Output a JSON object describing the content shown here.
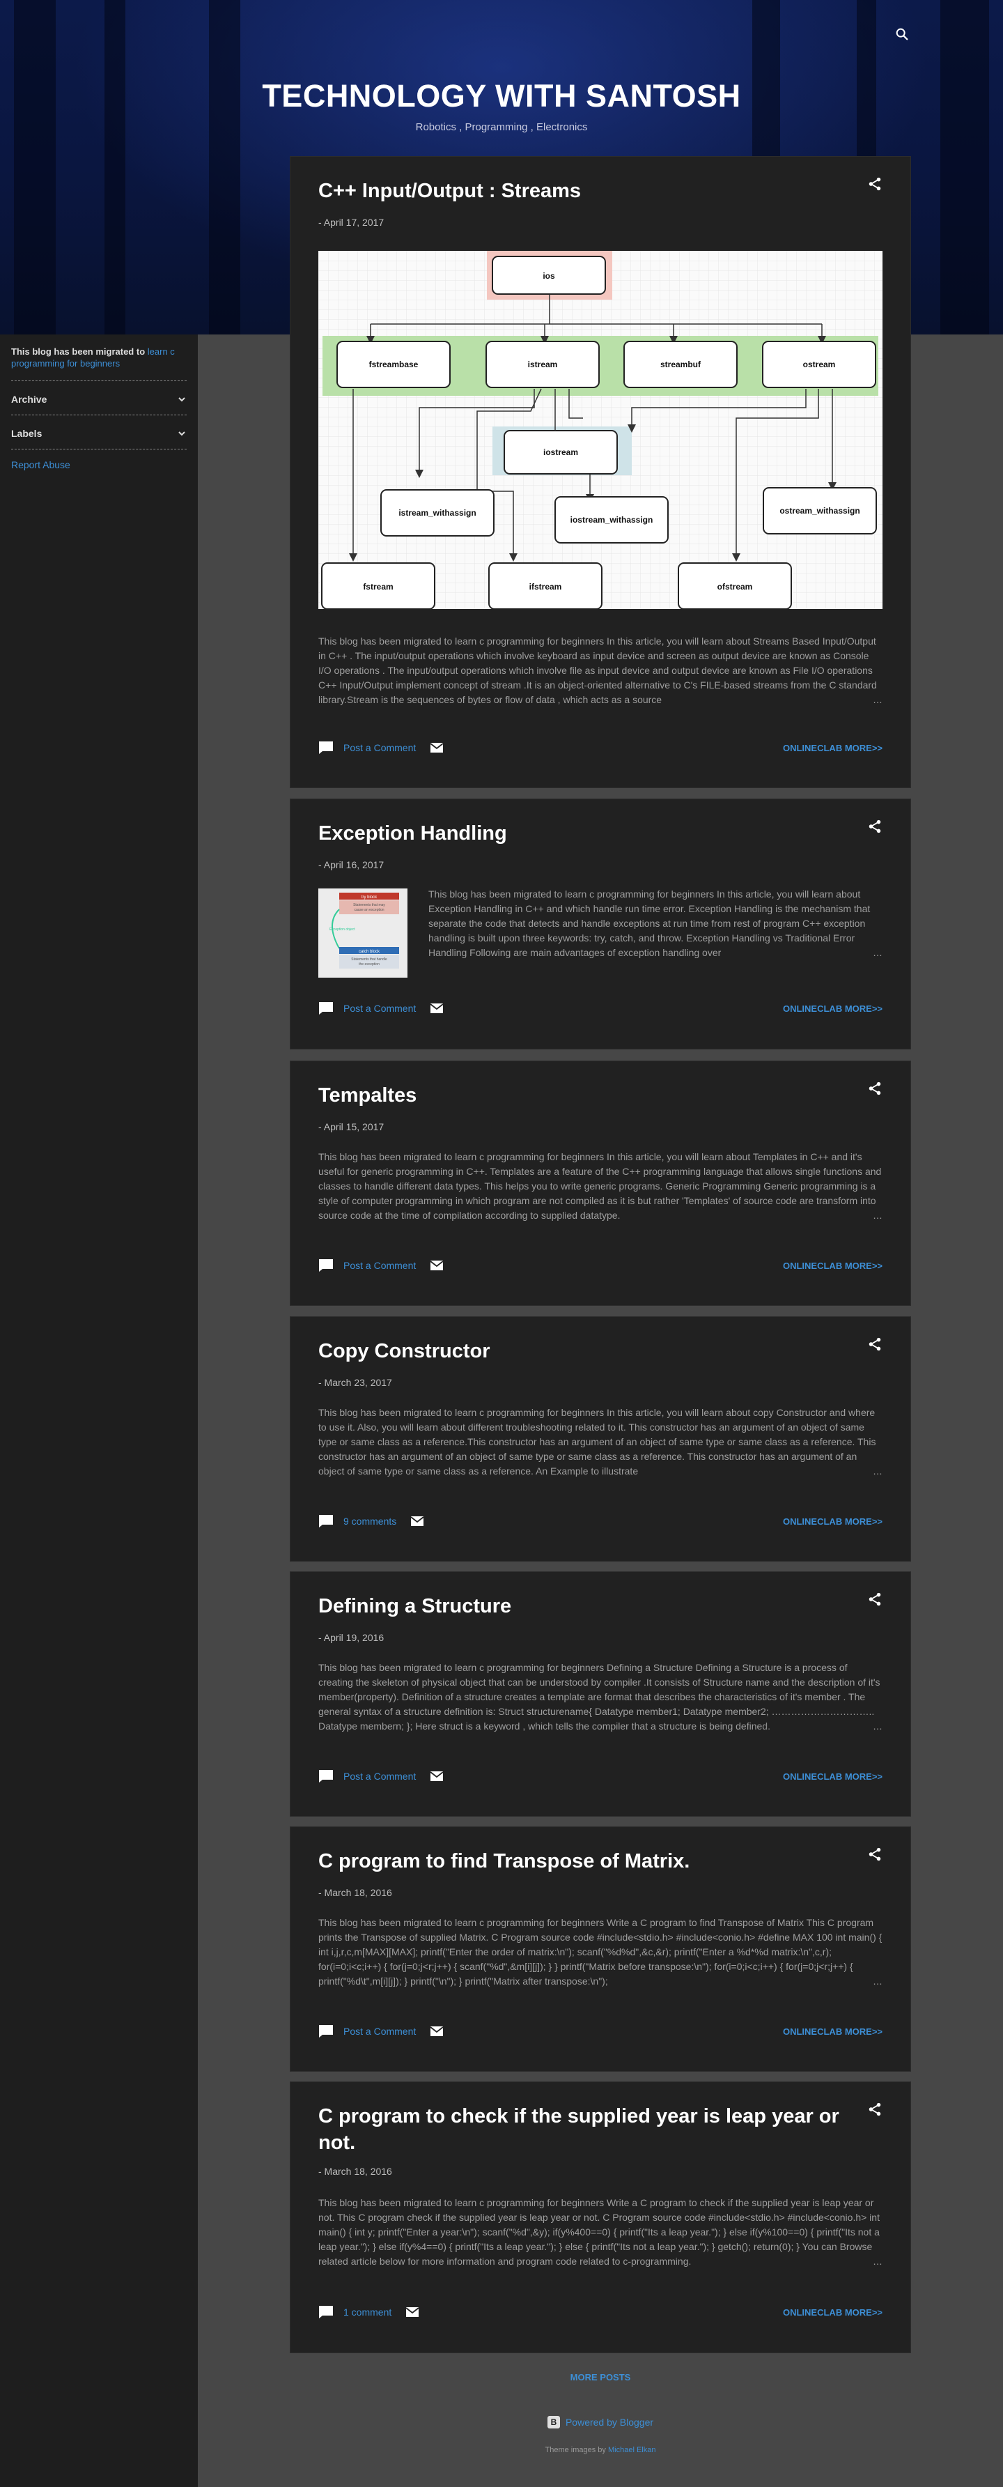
{
  "header": {
    "title": "TECHNOLOGY WITH SANTOSH",
    "subtitle": "Robotics , Programming , Electronics"
  },
  "sidebar": {
    "note_bold": "This blog has been migrated to",
    "note_link": "learn c programming for beginners",
    "archive": "Archive",
    "labels": "Labels",
    "report": "Report Abuse"
  },
  "diagram": {
    "nodes": [
      "ios",
      "fstreambase",
      "istream",
      "streambuf",
      "ostream",
      "iostream",
      "istream_withassign",
      "iostream_withassign",
      "ostream_withassign",
      "fstream",
      "ifstream",
      "ofstream"
    ]
  },
  "thumb2": {
    "lines": [
      "try block",
      "Statements that may",
      "cause an exception",
      "Exception object",
      "catch block",
      "Statements that handle",
      "the exception"
    ]
  },
  "posts": [
    {
      "title": "C++ Input/Output : Streams",
      "date": "- April 17, 2017",
      "snippet": "This blog has been migrated to learn c programming for beginners In this article, you will learn about Streams Based Input/Output in C++ . The input/output operations which involve keyboard as input device and screen as output device are known as Console I/O operations . The input/output operations which involve file as input device and output device are known as File I/O operations C++ Input/Output implement concept of stream .It is an object-oriented alternative to C's FILE-based streams from the C standard library.Stream is the sequences of bytes or flow of data , which acts as a source",
      "comments": "Post a Comment",
      "more": "ONLINECLAB MORE>>"
    },
    {
      "title": "Exception Handling",
      "date": "- April 16, 2017",
      "snippet": "This blog has been migrated to learn c programming for beginners In this article, you will learn about Exception Handling in C++ and which handle run time error. Exception Handling is the mechanism that separate the code that detects and handle exceptions at run time from rest of program C++ exception handling is built upon three keywords: try, catch, and throw. Exception Handling vs Traditional Error Handling Following are main advantages of exception handling over",
      "comments": "Post a Comment",
      "more": "ONLINECLAB MORE>>"
    },
    {
      "title": "Tempaltes",
      "date": "- April 15, 2017",
      "snippet": "This blog has been migrated to learn c programming for beginners In this article, you will learn about Templates in C++ and it's useful for generic programming in C++. Templates are a feature of the C++ programming language that allows single functions and classes to handle different data types. This helps you to write generic programs. Generic Programming Generic programming is a style of computer programming in which program are not compiled as it is but rather 'Templates' of source code are transform into source code at the time of compilation according to supplied datatype.",
      "comments": "Post a Comment",
      "more": "ONLINECLAB MORE>>"
    },
    {
      "title": "Copy Constructor",
      "date": "- March 23, 2017",
      "snippet": "This blog has been migrated to learn c programming for beginners In this article, you will learn about copy Constructor and where to use it. Also, you will learn about different troubleshooting related to it. This constructor has an argument of an object of same type or same class as a reference.This constructor has an argument of an object of same type or same class as a reference. This constructor has an argument of an object of same type or same class as a reference. This constructor has an argument of an object of same type or same class as a reference. An Example to illustrate",
      "comments": "9 comments",
      "more": "ONLINECLAB MORE>>"
    },
    {
      "title": "Defining a Structure",
      "date": "- April 19, 2016",
      "snippet": "This blog has been migrated to learn c programming for beginners Defining a Structure Defining a Structure is a process of creating the skeleton of physical object that can be understood by compiler .It consists of Structure name and the description of it's member(property). Definition of a structure creates a template are format that describes the characteristics of it's member . The general syntax of a structure definition is: Struct structurename{ Datatype member1; Datatype member2; ………………………….. Datatype membern; }; Here struct is a keyword , which tells the compiler that a structure is being defined.",
      "comments": "Post a Comment",
      "more": "ONLINECLAB MORE>>"
    },
    {
      "title": "C program to find Transpose of Matrix.",
      "date": "- March 18, 2016",
      "snippet": "This blog has been migrated to learn c programming for beginners Write a C program to find Transpose of Matrix  This C program prints the Transpose of supplied Matrix. C Program source code #include<stdio.h> #include<conio.h> #define MAX 100 int main() {   int i,j,r,c,m[MAX][MAX];   printf(\"Enter the order of matrix:\\n\");   scanf(\"%d%d\",&c,&r);   printf(\"Enter a %d*%d matrix:\\n\",c,r);   for(i=0;i<c;i++)   {     for(j=0;j<r;j++)     {       scanf(\"%d\",&m[i][j]);     }   }   printf(\"Matrix before transpose:\\n\");   for(i=0;i<c;i++)   {     for(j=0;j<r;j++)     {       printf(\"%d\\t\",m[i][j]);     }     printf(\"\\n\");   }   printf(\"Matrix after transpose:\\n\");",
      "comments": "Post a Comment",
      "more": "ONLINECLAB MORE>>"
    },
    {
      "title": "C program to check if the supplied year is leap year or not.",
      "date": "- March 18, 2016",
      "snippet": "This blog has been migrated to learn c programming for beginners Write a C program to check if the supplied year is leap year or not.  This C program check if the supplied year is leap year or not. C Program source code #include<stdio.h> #include<conio.h> int main() {   int y;   printf(\"Enter a year:\\n\");   scanf(\"%d\",&y);   if(y%400==0)   {     printf(\"Its a leap year.\");   }   else if(y%100==0)   {     printf(\"Its not a leap year.\");   }   else if(y%4==0)   {     printf(\"Its a leap year.\");   }   else   {     printf(\"Its not a leap year.\");   }   getch();   return(0); } You can Browse related article below for more information and program code related to c-programming.",
      "comments": "1 comment",
      "more": "ONLINECLAB MORE>>"
    }
  ],
  "footer": {
    "more_posts": "MORE POSTS",
    "powered": "Powered by Blogger",
    "theme_prefix": "Theme images by",
    "theme_link": "Michael Elkan"
  },
  "icons": {
    "search": "search-icon",
    "share": "share-icon",
    "comment": "comment-icon",
    "mail": "mail-icon",
    "chevron": "chevron-down-icon"
  },
  "colors": {
    "page_bg": "#474747",
    "card_bg": "#212121",
    "sidebar_bg": "#1e1e1e",
    "link": "#3d8fd6"
  }
}
